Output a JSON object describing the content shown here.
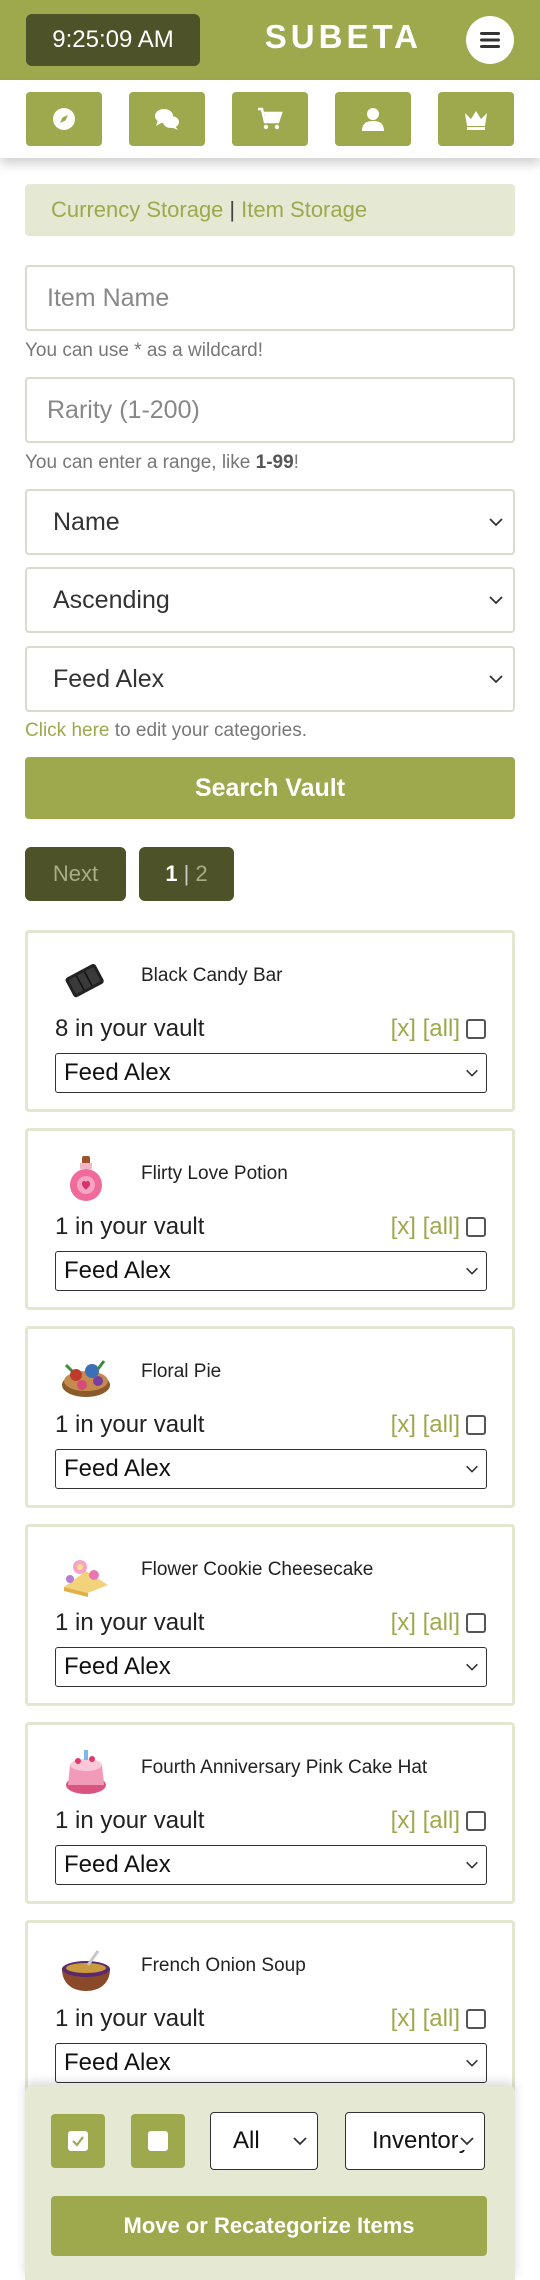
{
  "header": {
    "time": "9:25:09 AM",
    "brand": "SUBETA"
  },
  "nav": {
    "icons": [
      "compass-icon",
      "chat-icon",
      "cart-icon",
      "user-icon",
      "crown-icon"
    ]
  },
  "storage_tabs": {
    "currency": "Currency Storage",
    "separator": "|",
    "item": "Item Storage"
  },
  "search": {
    "item_name_placeholder": "Item Name",
    "wildcard_hint": "You can use * as a wildcard!",
    "rarity_placeholder": "Rarity (1-200)",
    "range_hint_prefix": "You can enter a range, like ",
    "range_hint_example": "1-99",
    "range_hint_suffix": "!",
    "sort_field": "Name",
    "sort_order": "Ascending",
    "category": "Feed Alex",
    "categories_link": "Click here",
    "categories_text": " to edit your categories.",
    "submit_label": "Search Vault"
  },
  "pagination": {
    "next_label": "Next",
    "current_page": "1",
    "separator": "|",
    "other_page": "2"
  },
  "items": [
    {
      "name": "Black Candy Bar",
      "count": "8 in your vault",
      "remove": "[x]",
      "all": "[all]",
      "category": "Feed Alex"
    },
    {
      "name": "Flirty Love Potion",
      "count": "1 in your vault",
      "remove": "[x]",
      "all": "[all]",
      "category": "Feed Alex"
    },
    {
      "name": "Floral Pie",
      "count": "1 in your vault",
      "remove": "[x]",
      "all": "[all]",
      "category": "Feed Alex"
    },
    {
      "name": "Flower Cookie Cheesecake",
      "count": "1 in your vault",
      "remove": "[x]",
      "all": "[all]",
      "category": "Feed Alex"
    },
    {
      "name": "Fourth Anniversary Pink Cake Hat",
      "count": "1 in your vault",
      "remove": "[x]",
      "all": "[all]",
      "category": "Feed Alex"
    },
    {
      "name": "French Onion Soup",
      "count": "1 in your vault",
      "remove": "[x]",
      "all": "[all]",
      "category": "Feed Alex"
    }
  ],
  "bottom_bar": {
    "filter_value": "All",
    "destination_value": "Inventory",
    "move_label": "Move or Recategorize Items"
  },
  "colors": {
    "accent": "#9ea84c",
    "dark": "#4e5228",
    "panel": "#e5e9d3"
  }
}
